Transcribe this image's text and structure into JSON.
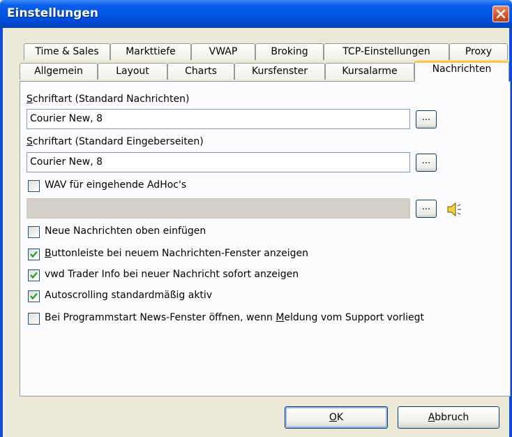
{
  "window": {
    "title": "Einstellungen"
  },
  "tabs_row1": [
    "Time & Sales",
    "Markttiefe",
    "VWAP",
    "Broking",
    "TCP-Einstellungen",
    "Proxy"
  ],
  "tabs_row2": [
    "Allgemein",
    "Layout",
    "Charts",
    "Kursfenster",
    "Kursalarme",
    "Nachrichten"
  ],
  "font_news": {
    "label_first": "S",
    "label_rest": "chriftart (Standard Nachrichten)",
    "value": "Courier New, 8",
    "button": "..."
  },
  "font_input": {
    "label_first": "S",
    "label_rest": "chriftart (Standard Eingeberseiten)",
    "value": "Courier New, 8",
    "button": "..."
  },
  "wav": {
    "label": "WAV für eingehende AdHoc's",
    "checked": false,
    "value": "",
    "button": "..."
  },
  "options": [
    {
      "pre": "",
      "u": "",
      "post": "Neue Nachrichten oben einfügen",
      "checked": false
    },
    {
      "pre": "",
      "u": "B",
      "post": "uttonleiste bei neuem Nachrichten-Fenster anzeigen",
      "checked": true
    },
    {
      "pre": "",
      "u": "",
      "post": "vwd Trader Info bei neuer Nachricht sofort anzeigen",
      "checked": true
    },
    {
      "pre": "",
      "u": "",
      "post": "Autoscrolling standardmäßig aktiv",
      "checked": true
    },
    {
      "pre": "Bei Programmstart News-Fenster öffnen, wenn ",
      "u": "M",
      "post": "eldung vom Support vorliegt",
      "checked": false
    }
  ],
  "buttons": {
    "ok_u": "O",
    "ok_rest": "K",
    "cancel_u": "A",
    "cancel_rest": "bbruch"
  },
  "colors": {
    "title_bar": "#0054e3",
    "active_tab_accent": "#ffc83c",
    "check": "#21a121"
  },
  "icons": {
    "close": "close-icon",
    "speaker": "speaker-icon"
  }
}
